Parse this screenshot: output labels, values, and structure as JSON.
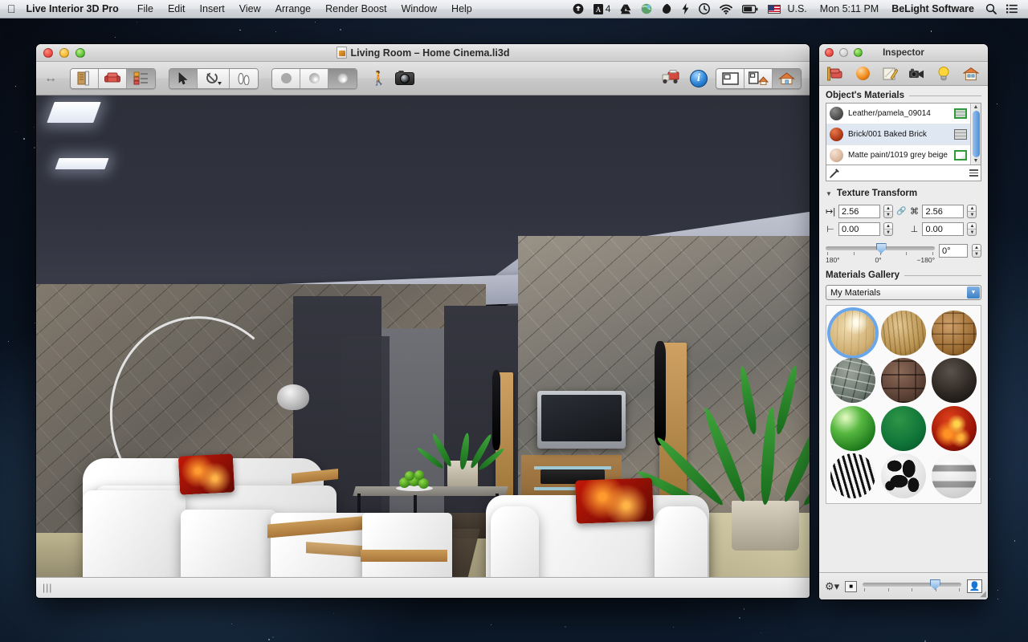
{
  "menubar": {
    "apple_icon": "apple-logo",
    "app_name": "Live Interior 3D Pro",
    "items": [
      "File",
      "Edit",
      "Insert",
      "View",
      "Arrange",
      "Render Boost",
      "Window",
      "Help"
    ],
    "right": {
      "dropbox_icon": "dropbox-icon",
      "adobe_icon": "adobe-cc-icon",
      "adobe_count": "4",
      "drive_icon": "google-drive-icon",
      "globe_icon": "network-globe-icon",
      "leaf_icon": "leaf-icon",
      "bolt_icon": "bolt-icon",
      "clock_icon": "time-machine-icon",
      "wifi_icon": "wifi-icon",
      "battery_icon": "battery-icon",
      "flag_icon": "us-flag-icon",
      "input_label": "U.S.",
      "clock": "Mon 5:11 PM",
      "user": "BeLight Software",
      "search_icon": "search-icon",
      "notifications_icon": "notification-center-icon"
    }
  },
  "window": {
    "title": "Living Room – Home Cinema.li3d",
    "doc_icon": "document-icon",
    "traffic": {
      "close": "close-button",
      "minimize": "minimize-button",
      "zoom": "zoom-button"
    },
    "toolbar": {
      "resize_icon": "horizontal-arrows-icon",
      "group_editor": [
        {
          "name": "open-library-button",
          "icon": "bookshelf-icon",
          "state": "off"
        },
        {
          "name": "furniture-library-button",
          "icon": "armchair-icon",
          "state": "off"
        },
        {
          "name": "project-tree-button",
          "icon": "list-outline-icon",
          "state": "on"
        }
      ],
      "group_tools": [
        {
          "name": "select-tool-button",
          "icon": "arrow-cursor-icon",
          "state": "on"
        },
        {
          "name": "rotate-tool-button",
          "icon": "rotate-icon",
          "state": "off"
        },
        {
          "name": "walk-tool-button",
          "icon": "footprints-icon",
          "state": "off"
        }
      ],
      "group_render": [
        {
          "name": "flat-shading-button",
          "icon": "flat-sphere-icon",
          "state": "off"
        },
        {
          "name": "shaded-button",
          "icon": "shaded-sphere-icon",
          "state": "off"
        },
        {
          "name": "glossy-render-button",
          "icon": "glossy-sphere-icon",
          "state": "on"
        }
      ],
      "walkthrough_icon": "walking-person-icon",
      "camera_icon": "camera-icon",
      "truck_icon": "delivery-truck-icon",
      "info_icon": "info-button-icon",
      "group_views": [
        {
          "name": "plan-view-button",
          "icon": "floor-plan-icon",
          "state": "off"
        },
        {
          "name": "split-view-button",
          "icon": "split-plan-3d-icon",
          "state": "off"
        },
        {
          "name": "3d-view-button",
          "icon": "house-3d-icon",
          "state": "on"
        }
      ]
    },
    "statusbar": {
      "grip_icon": "resize-grip-icon"
    }
  },
  "scene": {
    "name": "living-room-3d-render",
    "description": "Living room home cinema 3D render"
  },
  "inspector": {
    "title": "Inspector",
    "traffic": {
      "close": "close-button",
      "minimize": "minimize-button",
      "zoom": "zoom-button"
    },
    "tabs": [
      {
        "name": "tab-object",
        "icon": "furniture-ruler-icon",
        "active": false
      },
      {
        "name": "tab-materials",
        "icon": "orange-sphere-icon",
        "active": false
      },
      {
        "name": "tab-edit",
        "icon": "pencil-canvas-icon",
        "active": false
      },
      {
        "name": "tab-camera",
        "icon": "video-camera-icon",
        "active": false
      },
      {
        "name": "tab-light",
        "icon": "lightbulb-icon",
        "active": false
      },
      {
        "name": "tab-building",
        "icon": "house-icon",
        "active": false
      }
    ],
    "materials_section": {
      "title": "Object's Materials",
      "items": [
        {
          "name": "Leather/pamela_09014",
          "color": "#4f504e",
          "badge": "brick-green-icon",
          "selected": false
        },
        {
          "name": "Brick/001 Baked Brick",
          "color": "#b03a18",
          "badge": "brick-grey-icon",
          "selected": true
        },
        {
          "name": "Matte paint/1019 grey beige",
          "color": "#dcb9a0",
          "badge": "paint-green-icon",
          "selected": false
        }
      ],
      "eyedropper_icon": "eyedropper-icon",
      "menu_icon": "hamburger-menu-icon",
      "scroll_up_icon": "scroll-up-arrow",
      "scroll_down_icon": "scroll-down-arrow"
    },
    "texture_transform": {
      "title": "Texture Transform",
      "disclosure_icon": "disclosure-triangle-open",
      "width_icon": "horizontal-size-icon",
      "width_value": "2.56",
      "link_icon": "link-chain-icon",
      "height_icon": "vertical-size-icon",
      "height_value": "2.56",
      "offset_x_icon": "horizontal-offset-icon",
      "offset_x_value": "0.00",
      "offset_y_icon": "vertical-offset-icon",
      "offset_y_value": "0.00",
      "rotation_value": "0°",
      "slider_labels": [
        "180°",
        "0°",
        "−180°"
      ],
      "slider_position_percent": 46
    },
    "materials_gallery": {
      "title": "Materials Gallery",
      "selected_collection": "My Materials",
      "caret_icon": "chevron-down-icon",
      "swatches": [
        {
          "name": "light-wood-planks",
          "selected": true
        },
        {
          "name": "oak-wood",
          "selected": false
        },
        {
          "name": "parquet-basketweave",
          "selected": false
        },
        {
          "name": "stone-wall",
          "selected": false
        },
        {
          "name": "dark-brick",
          "selected": false
        },
        {
          "name": "black-leather",
          "selected": false
        },
        {
          "name": "green-gloss",
          "selected": false
        },
        {
          "name": "dark-green-matte",
          "selected": false
        },
        {
          "name": "fire-lava",
          "selected": false
        },
        {
          "name": "zebra-print",
          "selected": false
        },
        {
          "name": "cow-print",
          "selected": false
        },
        {
          "name": "chrome-metal",
          "selected": false
        }
      ]
    },
    "footer": {
      "gear_icon": "gear-action-menu",
      "small_preview_icon": "small-thumbnail-icon",
      "large_preview_icon": "large-thumbnail-icon",
      "zoom_position_percent": 68,
      "resize_grip_icon": "resize-grip-icon"
    }
  },
  "colors": {
    "accent": "#4b8fd6",
    "selection": "#dfe7f2",
    "menubar_bg": "#e4e6e9",
    "panel_bg": "#ececec"
  }
}
